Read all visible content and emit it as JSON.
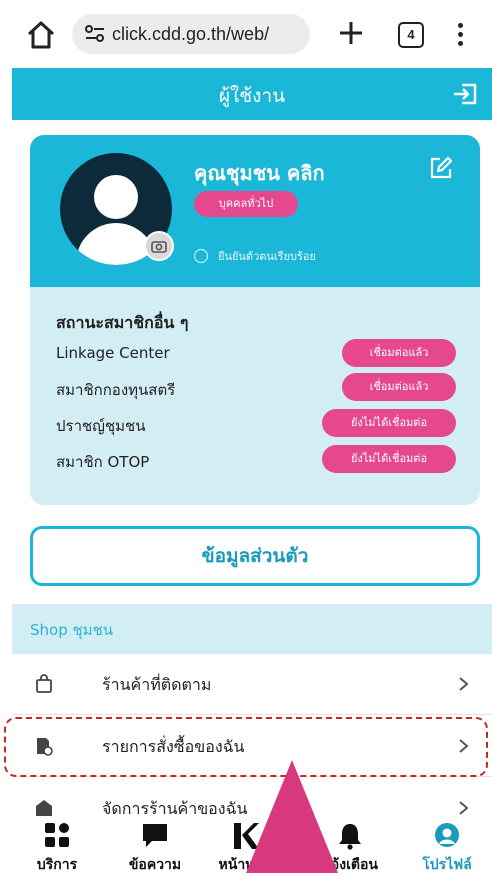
{
  "browser": {
    "url": "click.cdd.go.th/web/",
    "tab_count": "4"
  },
  "header": {
    "title": "ผู้ใช้งาน"
  },
  "profile": {
    "name": "คุณชุมชน คลิก",
    "role": "บุคคลทั่วไป",
    "verified_text": "ยืนยันตัวตนเรียบร้อย"
  },
  "member_status": {
    "title": "สถานะสมาชิกอื่น ๆ",
    "rows": [
      {
        "label": "Linkage Center",
        "status": "เชื่อมต่อแล้ว"
      },
      {
        "label": "สมาชิกกองทุนสตรี",
        "status": "เชื่อมต่อแล้ว"
      },
      {
        "label": "ปราชญ์ชุมชน",
        "status": "ยังไม่ได้เชื่อมต่อ"
      },
      {
        "label": "สมาชิก OTOP",
        "status": "ยังไม่ได้เชื่อมต่อ"
      }
    ]
  },
  "personal_info_button": "ข้อมูลส่วนตัว",
  "shop": {
    "section_title": "Shop ชุมชน",
    "items": [
      {
        "label": "ร้านค้าที่ติดตาม",
        "icon": "bag-icon"
      },
      {
        "label": "รายการสั่งซื้อของฉัน",
        "icon": "receipt-icon"
      },
      {
        "label": "จัดการร้านค้าของฉัน",
        "icon": "store-icon"
      }
    ]
  },
  "bottom_nav": [
    {
      "label": "บริการ",
      "icon": "grid-icon"
    },
    {
      "label": "ข้อความ",
      "icon": "chat-icon"
    },
    {
      "label": "หน้าหลัก",
      "icon": "home-logo-icon"
    },
    {
      "label": "แจ้งเตือน",
      "icon": "bell-icon"
    },
    {
      "label": "โปรไฟล์",
      "icon": "profile-icon",
      "active": true
    }
  ],
  "colors": {
    "primary": "#1ab7d9",
    "accent_pink": "#e6488d",
    "light_panel": "#d2eef4",
    "highlight_border": "#c62828"
  }
}
